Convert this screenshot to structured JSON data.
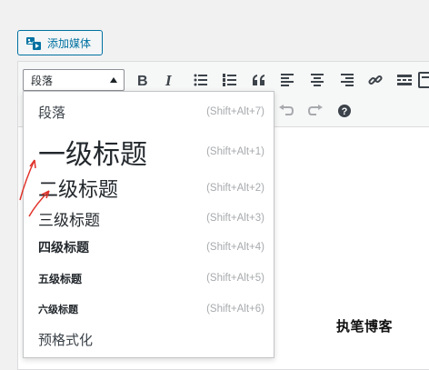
{
  "media": {
    "add_label": "添加媒体",
    "icon": "media-icon"
  },
  "toolbar": {
    "format_value": "段落",
    "buttons": [
      "bold",
      "italic",
      "bullet-list",
      "numbered-list",
      "blockquote",
      "align-left",
      "align-center",
      "align-right",
      "link",
      "read-more",
      "toolbar-toggle"
    ],
    "row2_buttons": [
      "undo",
      "redo",
      "help"
    ]
  },
  "format_menu": {
    "items": [
      {
        "label": "段落",
        "shortcut": "(Shift+Alt+7)"
      },
      {
        "label": "一级标题",
        "shortcut": "(Shift+Alt+1)"
      },
      {
        "label": "二级标题",
        "shortcut": "(Shift+Alt+2)"
      },
      {
        "label": "三级标题",
        "shortcut": "(Shift+Alt+3)"
      },
      {
        "label": "四级标题",
        "shortcut": "(Shift+Alt+4)"
      },
      {
        "label": "五级标题",
        "shortcut": "(Shift+Alt+5)"
      },
      {
        "label": "六级标题",
        "shortcut": "(Shift+Alt+6)"
      },
      {
        "label": "预格式化",
        "shortcut": ""
      }
    ]
  },
  "watermark": {
    "text": "执笔博客"
  },
  "colors": {
    "accent": "#0071a1",
    "annotation": "#e0332b"
  }
}
